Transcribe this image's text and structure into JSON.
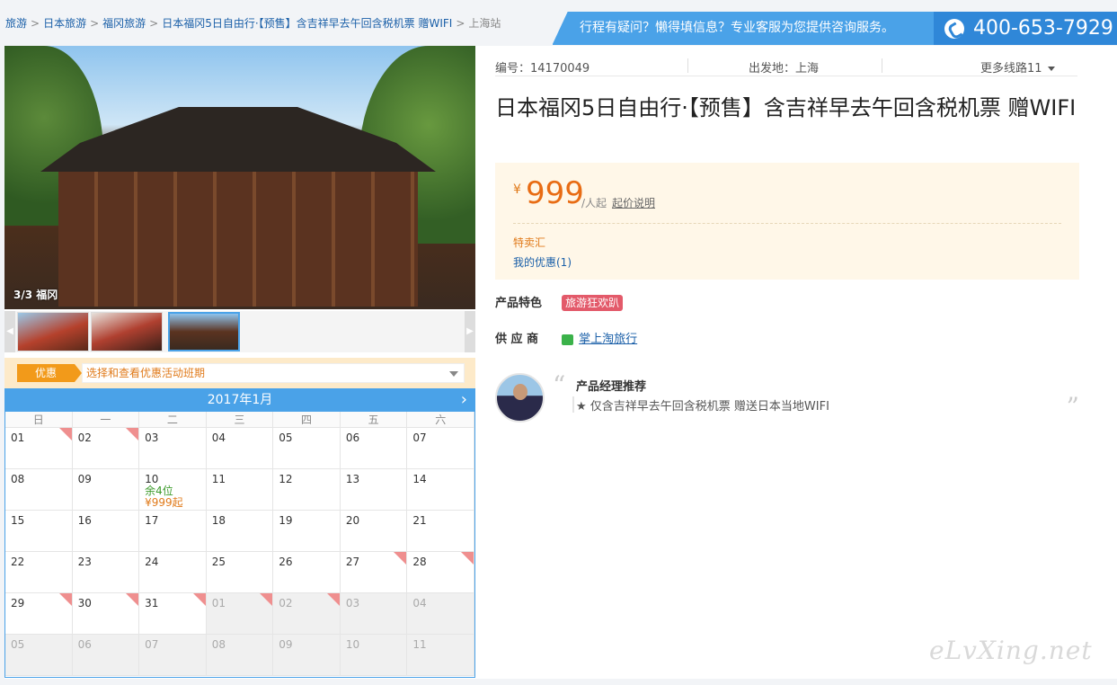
{
  "breadcrumb": {
    "items": [
      "旅游",
      "日本旅游",
      "福冈旅游",
      "日本福冈5日自由行·【预售】含吉祥早去午回含税机票 赠WIFI"
    ],
    "current": "上海站",
    "separator": ">"
  },
  "hotline": {
    "message": "行程有疑问？懒得填信息？专业客服为您提供咨询服务。",
    "phone": "400-653-7929"
  },
  "gallery": {
    "caption": "3/3 福冈",
    "prev": "◀",
    "next": "▶"
  },
  "promo": {
    "tag": "优惠",
    "placeholder": "选择和查看优惠活动班期"
  },
  "calendar": {
    "month": "2017年1月",
    "next": "›",
    "weekdays": [
      "日",
      "一",
      "二",
      "三",
      "四",
      "五",
      "六"
    ],
    "days": [
      {
        "d": "01",
        "mark": true
      },
      {
        "d": "02",
        "mark": true
      },
      {
        "d": "03"
      },
      {
        "d": "04"
      },
      {
        "d": "05"
      },
      {
        "d": "06"
      },
      {
        "d": "07"
      },
      {
        "d": "08"
      },
      {
        "d": "09"
      },
      {
        "d": "10",
        "rest": "余4位",
        "price": "¥999起"
      },
      {
        "d": "11"
      },
      {
        "d": "12"
      },
      {
        "d": "13"
      },
      {
        "d": "14"
      },
      {
        "d": "15"
      },
      {
        "d": "16"
      },
      {
        "d": "17"
      },
      {
        "d": "18"
      },
      {
        "d": "19"
      },
      {
        "d": "20"
      },
      {
        "d": "21"
      },
      {
        "d": "22"
      },
      {
        "d": "23"
      },
      {
        "d": "24"
      },
      {
        "d": "25"
      },
      {
        "d": "26"
      },
      {
        "d": "27",
        "mark": true
      },
      {
        "d": "28",
        "mark": true
      },
      {
        "d": "29",
        "mark": true
      },
      {
        "d": "30",
        "mark": true
      },
      {
        "d": "31",
        "mark": true
      },
      {
        "d": "01",
        "other": true,
        "mark": true
      },
      {
        "d": "02",
        "other": true,
        "mark": true
      },
      {
        "d": "03",
        "other": true
      },
      {
        "d": "04",
        "other": true
      },
      {
        "d": "05",
        "other": true
      },
      {
        "d": "06",
        "other": true
      },
      {
        "d": "07",
        "other": true
      },
      {
        "d": "08",
        "other": true
      },
      {
        "d": "09",
        "other": true
      },
      {
        "d": "10",
        "other": true
      },
      {
        "d": "11",
        "other": true
      }
    ]
  },
  "product": {
    "code": "编号：14170049",
    "departure": "出发地：上海",
    "more_routes": "更多线路11",
    "title": "日本福冈5日自由行·【预售】含吉祥早去午回含税机票 赠WIFI",
    "currency": "¥",
    "price": "999",
    "unit": "/人起",
    "price_note": "起价说明",
    "sale": "特卖汇",
    "my_discount": "我的优惠(1)",
    "feature_label": "产品特色",
    "feature_badge": "旅游狂欢趴",
    "supplier_label": "供 应 商",
    "supplier_name": "掌上淘旅行",
    "pm_title": "产品经理推荐",
    "pm_text": "★ 仅含吉祥早去午回含税机票 赠送日本当地WIFI",
    "quote_open": "“",
    "quote_close": "”"
  },
  "watermark": "eLvXing.net",
  "colors": {
    "accent": "#4aa2e8",
    "price": "#e86c14",
    "link": "#1a5fa8",
    "badge": "#e35a6a"
  }
}
